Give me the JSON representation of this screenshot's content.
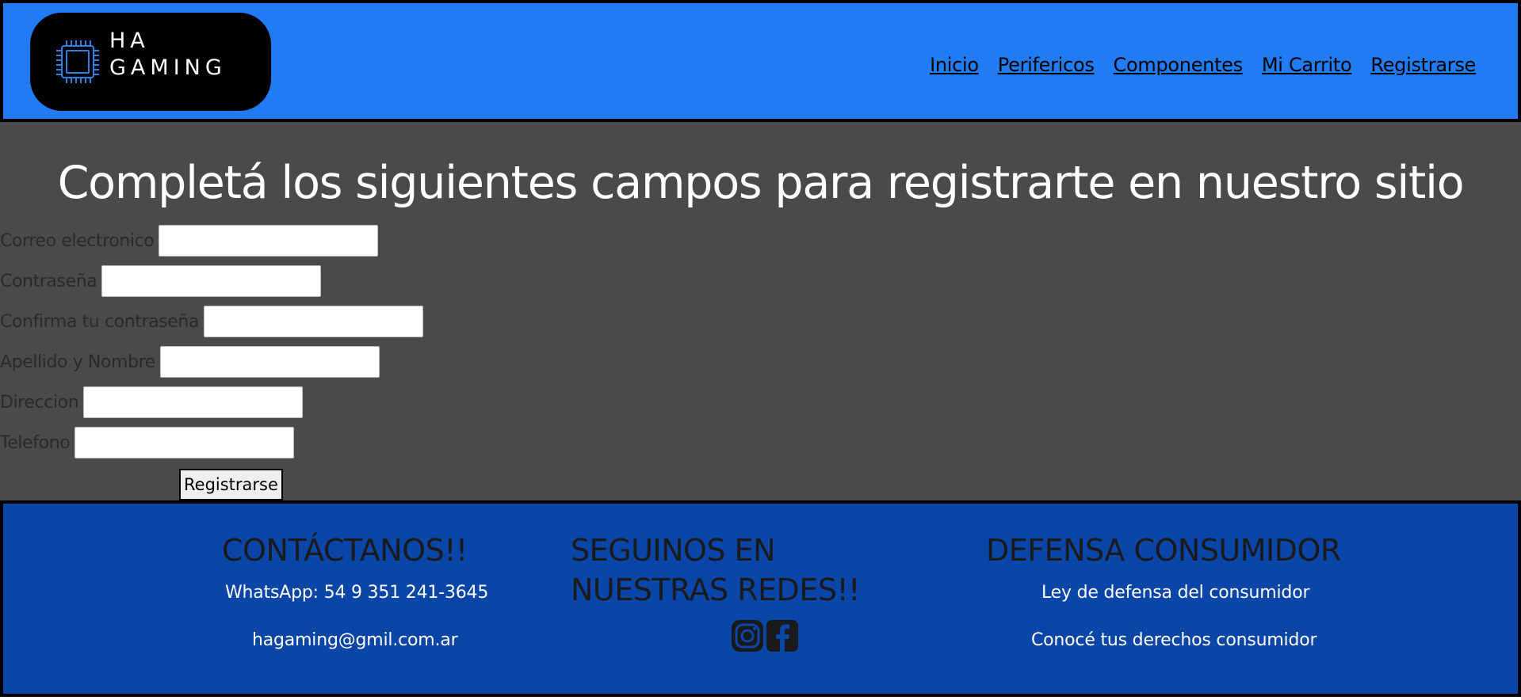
{
  "header": {
    "logo_line1": "HA",
    "logo_line2": "GAMING",
    "nav": [
      "Inicio",
      "Perifericos",
      "Componentes",
      "Mi Carrito",
      "Registrarse"
    ]
  },
  "main": {
    "title": "Completá los siguientes campos para registrarte en nuestro sitio",
    "fields": [
      {
        "label": "Correo electronico",
        "value": ""
      },
      {
        "label": "Contraseña",
        "value": ""
      },
      {
        "label": "Confirma tu contraseña",
        "value": ""
      },
      {
        "label": "Apellido y Nombre",
        "value": ""
      },
      {
        "label": "Direccion",
        "value": ""
      },
      {
        "label": "Telefono",
        "value": ""
      }
    ],
    "submit_label": "Registrarse"
  },
  "footer": {
    "contact_heading": "CONTÁCTANOS!!",
    "whatsapp": "WhatsApp: 54 9 351 241-3645",
    "email": "hagaming@gmil.com.ar",
    "social_heading_line1": "SEGUINOS EN",
    "social_heading_line2": "NUESTRAS REDES!!",
    "social_icons": [
      "instagram-icon",
      "facebook-icon"
    ],
    "consumer_heading": "DEFENSA CONSUMIDOR",
    "consumer_link1": "Ley de defensa del consumidor",
    "consumer_link2": "Conocé tus derechos consumidor"
  },
  "colors": {
    "header_bg": "#217bf4",
    "main_bg": "#4a4a4a",
    "footer_bg": "#0a45a8"
  }
}
